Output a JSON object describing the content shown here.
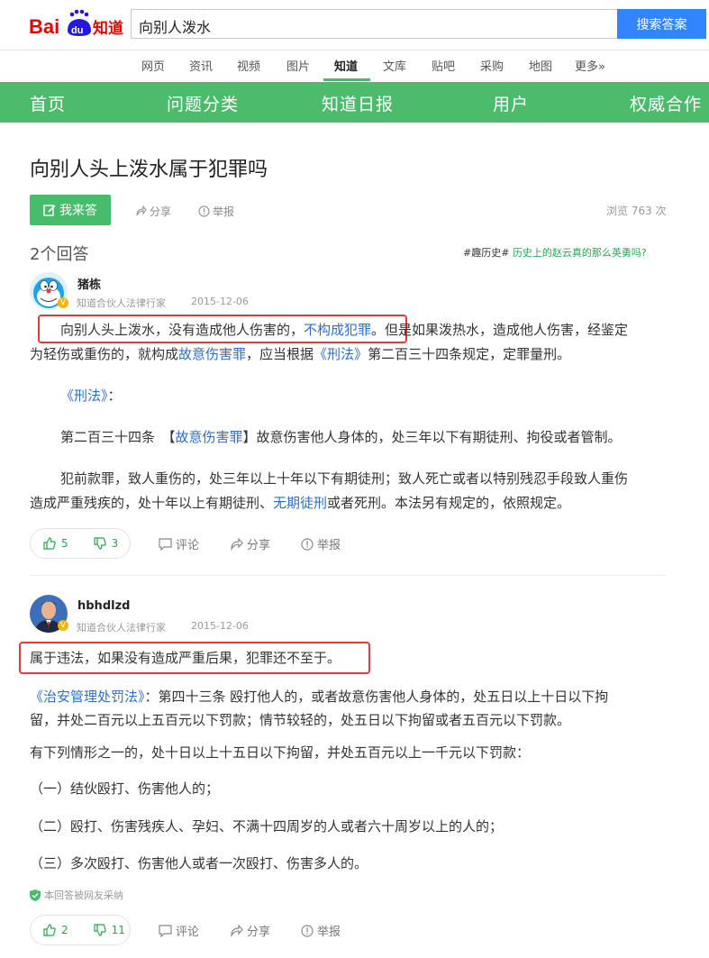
{
  "header": {
    "search_value": "向别人泼水",
    "search_button": "搜索答案",
    "nav": [
      "网页",
      "资讯",
      "视频",
      "图片",
      "知道",
      "文库",
      "贴吧",
      "采购",
      "地图",
      "更多»"
    ],
    "nav_active": "知道"
  },
  "greenbar": [
    "首页",
    "问题分类",
    "知道日报",
    "用户",
    "权威合作"
  ],
  "question": {
    "title": "向别人头上泼水属于犯罪吗",
    "answer_button": "我来答",
    "share": "分享",
    "report": "举报",
    "views": "浏览 763 次"
  },
  "answers_count": "2个回答",
  "promo": {
    "tag": "#趣历史#",
    "text": "历史上的赵云真的那么英勇吗?"
  },
  "answer1": {
    "name": "猪栋",
    "title": "知道合伙人法律行家",
    "date": "2015-12-06",
    "p1_a": "向别人头上泼水，没有造成他人伤害的，",
    "p1_link": "不构成犯罪",
    "p1_b": "。但是如果泼热水，造成他人伤害，经鉴定",
    "p1_c": "为轻伤或重伤的，就构成",
    "p1_link2": "故意伤害罪",
    "p1_d": "，应当根据",
    "p1_link3": "《刑法》",
    "p1_e": "第二百三十四条规定，定罪量刑。",
    "law_link": "《刑法》",
    "law_colon": "：",
    "art_a": "第二百三十四条　【",
    "art_link": "故意伤害罪",
    "art_b": "】故意伤害他人身体的，处三年以下有期徒刑、拘役或者管制。",
    "p3_a": "犯前款罪，致人重伤的，处三年以上十年以下有期徒刑；致人死亡或者以特别残忍手段致人重伤",
    "p3_b": "造成严重残疾的，处十年以上有期徒刑、",
    "p3_link": "无期徒刑",
    "p3_c": "或者死刑。本法另有规定的，依照规定。",
    "up": "5",
    "down": "3",
    "comment": "评论",
    "share": "分享",
    "report": "举报"
  },
  "answer2": {
    "name": "hbhdlzd",
    "title": "知道合伙人法律行家",
    "date": "2015-12-06",
    "p1": "属于违法，如果没有造成严重后果，犯罪还不至于。",
    "p2_link": "《治安管理处罚法》",
    "p2_a": "：第四十三条 殴打他人的，或者故意伤害他人身体的，处五日以上十日以下拘",
    "p2_b": "留，并处二百元以上五百元以下罚款；情节较轻的，处五日以下拘留或者五百元以下罚款。",
    "p3": "有下列情形之一的，处十日以上十五日以下拘留，并处五百元以上一千元以下罚款：",
    "i1": "（一）结伙殴打、伤害他人的；",
    "i2": "（二）殴打、伤害残疾人、孕妇、不满十四周岁的人或者六十周岁以上的人的；",
    "i3": "（三）多次殴打、伤害他人或者一次殴打、伤害多人的。",
    "adopted": "本回答被网友采纳",
    "up": "2",
    "down": "11",
    "comment": "评论",
    "share": "分享",
    "report": "举报"
  },
  "colors": {
    "green": "#4cbc6c",
    "link": "#2e6ec9",
    "red": "#e4393c",
    "blue": "#3385ff"
  }
}
